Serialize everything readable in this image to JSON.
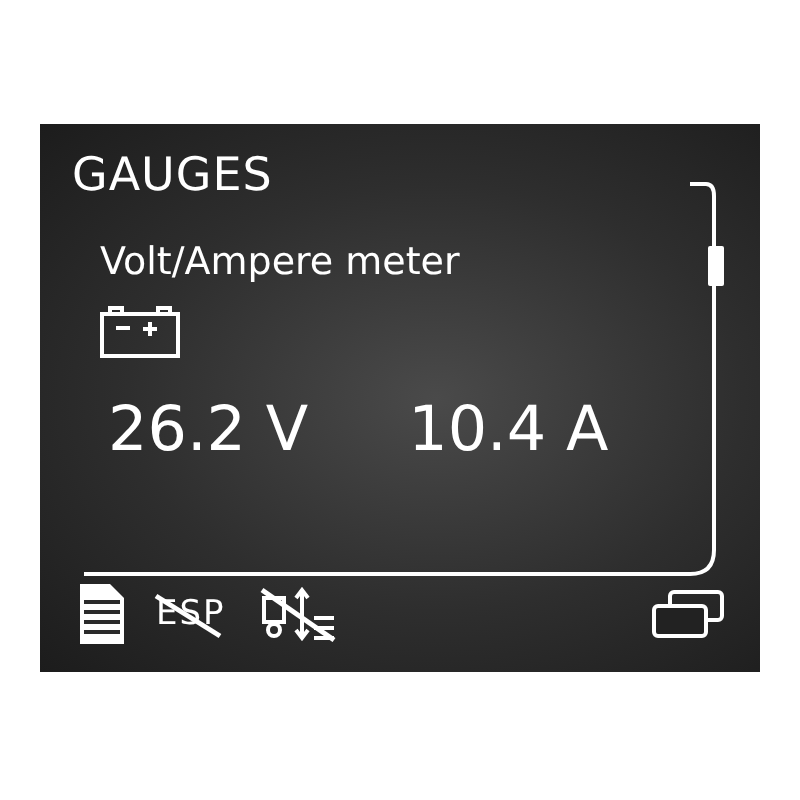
{
  "title": "GAUGES",
  "gauge": {
    "name": "Volt/Ampere meter",
    "readings": [
      "26.2 V",
      "10.4 A"
    ]
  },
  "status_bar": {
    "esp": {
      "label": "ESP",
      "off": true
    },
    "hill_descent_off": true
  }
}
